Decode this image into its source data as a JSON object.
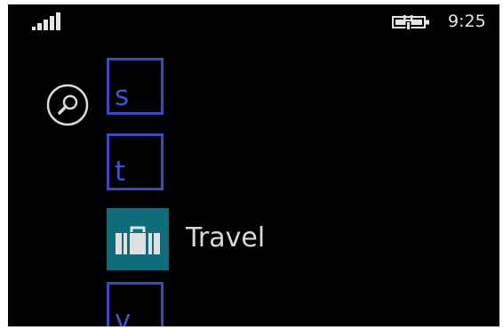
{
  "status_bar": {
    "signal_icon": "signal-strength-icon",
    "battery_icon": "battery-charging-icon",
    "time": "9:25"
  },
  "search": {
    "icon": "search-icon"
  },
  "app_list": {
    "items": [
      {
        "type": "letter",
        "label": "s"
      },
      {
        "type": "letter",
        "label": "t"
      },
      {
        "type": "app",
        "label": "Travel",
        "icon": "suitcase-icon",
        "tile_color": "#0f6c7b"
      },
      {
        "type": "letter",
        "label": "v"
      }
    ]
  },
  "colors": {
    "background": "#000000",
    "letter_accent": "#3a4bc0",
    "text": "#d9d9d9"
  }
}
